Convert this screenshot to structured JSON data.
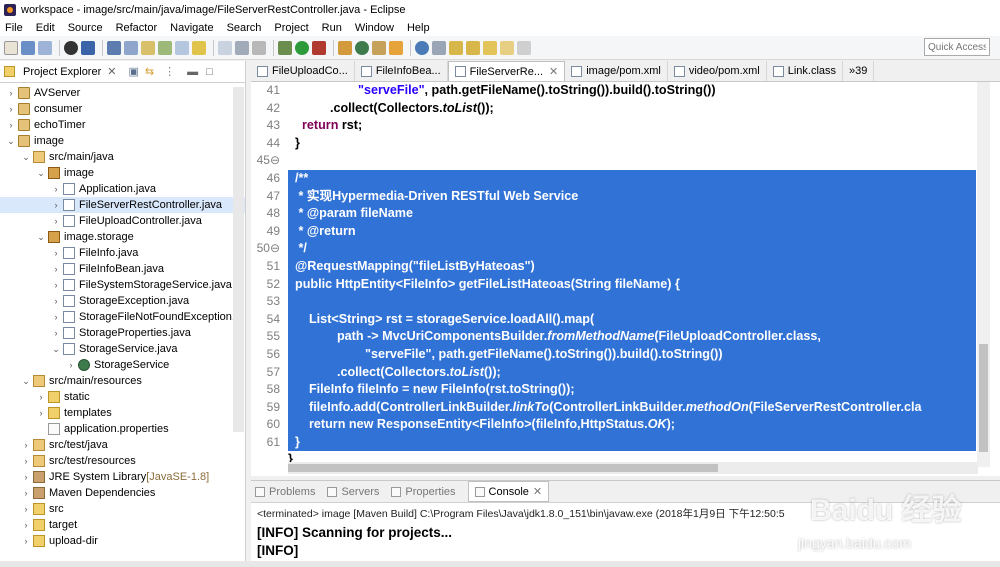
{
  "window": {
    "title": "workspace - image/src/main/java/image/FileServerRestController.java - Eclipse"
  },
  "menu": [
    "File",
    "Edit",
    "Source",
    "Refactor",
    "Navigate",
    "Search",
    "Project",
    "Run",
    "Window",
    "Help"
  ],
  "quick_access": {
    "placeholder": "Quick Access"
  },
  "explorer": {
    "title": "Project Explorer",
    "items": [
      {
        "label": "AVServer",
        "indent": 0,
        "twisty": "›",
        "icon": "proj"
      },
      {
        "label": "consumer",
        "indent": 0,
        "twisty": "›",
        "icon": "proj"
      },
      {
        "label": "echoTimer",
        "indent": 0,
        "twisty": "›",
        "icon": "proj"
      },
      {
        "label": "image",
        "indent": 0,
        "twisty": "⌄",
        "icon": "proj"
      },
      {
        "label": "src/main/java",
        "indent": 1,
        "twisty": "⌄",
        "icon": "src"
      },
      {
        "label": "image",
        "indent": 2,
        "twisty": "⌄",
        "icon": "pkg"
      },
      {
        "label": "Application.java",
        "indent": 3,
        "twisty": "›",
        "icon": "java"
      },
      {
        "label": "FileServerRestController.java",
        "indent": 3,
        "twisty": "›",
        "icon": "java",
        "selected": true
      },
      {
        "label": "FileUploadController.java",
        "indent": 3,
        "twisty": "›",
        "icon": "java"
      },
      {
        "label": "image.storage",
        "indent": 2,
        "twisty": "⌄",
        "icon": "pkg"
      },
      {
        "label": "FileInfo.java",
        "indent": 3,
        "twisty": "›",
        "icon": "java"
      },
      {
        "label": "FileInfoBean.java",
        "indent": 3,
        "twisty": "›",
        "icon": "java"
      },
      {
        "label": "FileSystemStorageService.java",
        "indent": 3,
        "twisty": "›",
        "icon": "java"
      },
      {
        "label": "StorageException.java",
        "indent": 3,
        "twisty": "›",
        "icon": "java"
      },
      {
        "label": "StorageFileNotFoundException.j",
        "indent": 3,
        "twisty": "›",
        "icon": "java"
      },
      {
        "label": "StorageProperties.java",
        "indent": 3,
        "twisty": "›",
        "icon": "java"
      },
      {
        "label": "StorageService.java",
        "indent": 3,
        "twisty": "⌄",
        "icon": "java"
      },
      {
        "label": "StorageService",
        "indent": 4,
        "twisty": "›",
        "icon": "cls"
      },
      {
        "label": "src/main/resources",
        "indent": 1,
        "twisty": "⌄",
        "icon": "src"
      },
      {
        "label": "static",
        "indent": 2,
        "twisty": "›",
        "icon": "folder"
      },
      {
        "label": "templates",
        "indent": 2,
        "twisty": "›",
        "icon": "folder"
      },
      {
        "label": "application.properties",
        "indent": 2,
        "twisty": "",
        "icon": "file"
      },
      {
        "label": "src/test/java",
        "indent": 1,
        "twisty": "›",
        "icon": "src"
      },
      {
        "label": "src/test/resources",
        "indent": 1,
        "twisty": "›",
        "icon": "src"
      },
      {
        "label": "JRE System Library",
        "suffix": "[JavaSE-1.8]",
        "indent": 1,
        "twisty": "›",
        "icon": "lib"
      },
      {
        "label": "Maven Dependencies",
        "indent": 1,
        "twisty": "›",
        "icon": "lib"
      },
      {
        "label": "src",
        "indent": 1,
        "twisty": "›",
        "icon": "folder"
      },
      {
        "label": "target",
        "indent": 1,
        "twisty": "›",
        "icon": "folder"
      },
      {
        "label": "upload-dir",
        "indent": 1,
        "twisty": "›",
        "icon": "folder"
      }
    ]
  },
  "editor": {
    "tabs": [
      {
        "label": "FileUploadCo..."
      },
      {
        "label": "FileInfoBea..."
      },
      {
        "label": "FileServerRe...",
        "active": true,
        "close": "✕"
      },
      {
        "label": "image/pom.xml"
      },
      {
        "label": "video/pom.xml"
      },
      {
        "label": "Link.class"
      }
    ],
    "overflow": "»39",
    "line_numbers": [
      "41",
      "42",
      "43",
      "44",
      "45⊖",
      "46",
      "47",
      "48",
      "49",
      "50⊖",
      "51",
      "52",
      "53",
      "54",
      "55",
      "56",
      "57",
      "58",
      "59",
      "60",
      "61"
    ],
    "lines": [
      {
        "hl": false,
        "html": "                    <span class=\"str\">\"serveFile\"</span>, path.getFileName().toString()).build().toString())"
      },
      {
        "hl": false,
        "html": "            .collect(Collectors.<span class=\"it\">toList</span>());"
      },
      {
        "hl": false,
        "html": "    <span class=\"kw\">return</span> rst;"
      },
      {
        "hl": false,
        "html": "  }"
      },
      {
        "hl": false,
        "html": ""
      },
      {
        "hl": true,
        "html": "  /**"
      },
      {
        "hl": true,
        "html": "   * 实现Hypermedia-Driven RESTful Web Service"
      },
      {
        "hl": true,
        "html": "   * @param fileName"
      },
      {
        "hl": true,
        "html": "   * @return"
      },
      {
        "hl": true,
        "html": "   */"
      },
      {
        "hl": true,
        "html": "  @RequestMapping(\"fileListByHateoas\")"
      },
      {
        "hl": true,
        "html": "  <span class=\"kw\">public</span> HttpEntity&lt;FileInfo&gt; getFileListHateoas(String fileName) {"
      },
      {
        "hl": true,
        "html": ""
      },
      {
        "hl": true,
        "html": "      List&lt;String&gt; rst = storageService.loadAll().map("
      },
      {
        "hl": true,
        "html": "              path -&gt; MvcUriComponentsBuilder.<span class=\"it\">fromMethodName</span>(FileUploadController.<span class=\"kw\">class</span>,"
      },
      {
        "hl": true,
        "html": "                      \"serveFile\", path.getFileName().toString()).build().toString())"
      },
      {
        "hl": true,
        "html": "              .collect(Collectors.<span class=\"it\">toList</span>());"
      },
      {
        "hl": true,
        "html": "      FileInfo fileInfo = <span class=\"kw\">new</span> FileInfo(rst.toString());"
      },
      {
        "hl": true,
        "html": "      fileInfo.add(ControllerLinkBuilder.<span class=\"it\">linkTo</span>(ControllerLinkBuilder.<span class=\"it\">methodOn</span>(FileServerRestController.<span class=\"kw\">cla</span>"
      },
      {
        "hl": true,
        "html": "      <span class=\"kw\">return</span> <span class=\"kw\">new</span> ResponseEntity&lt;FileInfo&gt;(fileInfo,HttpStatus.<span class=\"it\">OK</span>);"
      },
      {
        "hl": true,
        "html": "  }"
      }
    ],
    "last_line": "}"
  },
  "console": {
    "tabs": [
      {
        "label": "Problems"
      },
      {
        "label": "Servers"
      },
      {
        "label": "Properties"
      },
      {
        "label": "Console",
        "active": true
      }
    ],
    "terminated": "<terminated> image [Maven Build] C:\\Program Files\\Java\\jdk1.8.0_151\\bin\\javaw.exe (2018年1月9日 下午12:50:5",
    "lines": [
      "[INFO] Scanning for projects...",
      "[INFO]"
    ]
  },
  "watermark": {
    "logo": "Baidu 经验",
    "url": "jingyan.baidu.com"
  },
  "colors": {
    "selection": "#3072d6",
    "keyword": "#7f0055",
    "string": "#2a00ff"
  }
}
